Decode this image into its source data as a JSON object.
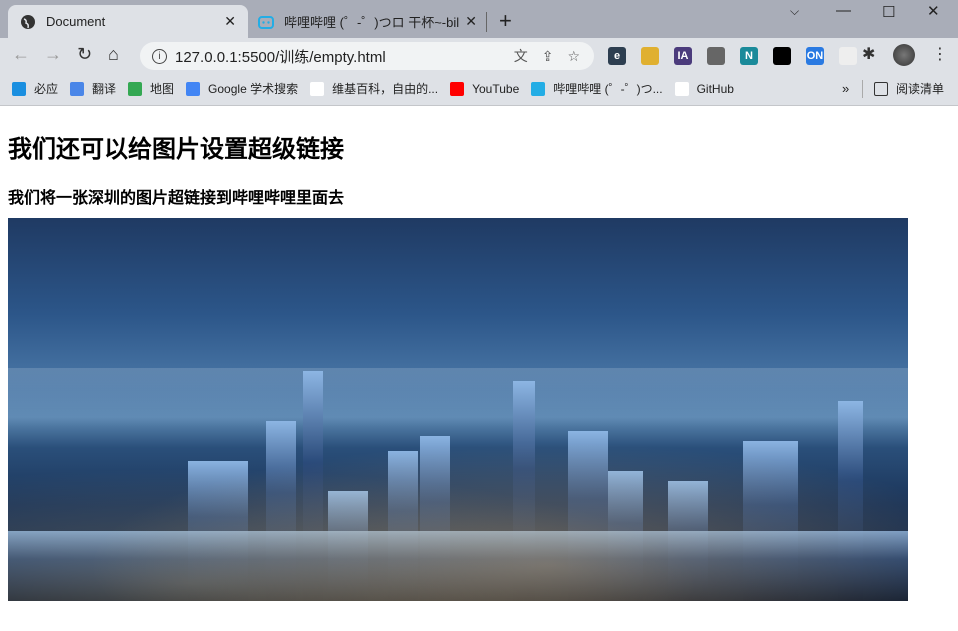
{
  "browser": {
    "tabs": [
      {
        "title": "Document",
        "active": true,
        "icon": "globe-icon"
      },
      {
        "title": "哔哩哔哩 (゜-゜)つロ 干杯~-bilil",
        "active": false,
        "icon": "bilibili-icon"
      }
    ],
    "address": "127.0.0.1:5500/训练/empty.html",
    "extensions": [
      {
        "icon": "e-icon",
        "label": "e",
        "color": "#2d3e50"
      },
      {
        "icon": "folder-clock-icon",
        "label": "",
        "color": "#e0b030"
      },
      {
        "icon": "ia-icon",
        "label": "IA",
        "color": "#4b3b7c"
      },
      {
        "icon": "copy-icon",
        "label": "",
        "color": "#666666"
      },
      {
        "icon": "n-icon",
        "label": "N",
        "color": "#1a8a9a"
      },
      {
        "icon": "tampermonkey-icon",
        "label": "",
        "color": "#000000"
      },
      {
        "icon": "info-on-icon",
        "label": "ON",
        "color": "#2a7ae2"
      },
      {
        "icon": "puzzle-piece-ext-icon",
        "label": "",
        "color": "#eeeeee"
      }
    ],
    "bookmarks": [
      {
        "label": "必应",
        "icon": "bing-icon",
        "color": "#1a8fe0"
      },
      {
        "label": "翻译",
        "icon": "google-translate-icon",
        "color": "#4a86e8"
      },
      {
        "label": "地图",
        "icon": "google-maps-icon",
        "color": "#34a853"
      },
      {
        "label": "Google 学术搜索",
        "icon": "scholar-icon",
        "color": "#4285f4"
      },
      {
        "label": "维基百科，自由的...",
        "icon": "wikipedia-icon",
        "color": "#ffffff"
      },
      {
        "label": "YouTube",
        "icon": "youtube-icon",
        "color": "#ff0000"
      },
      {
        "label": "哔哩哔哩 (゜-゜)つ...",
        "icon": "bilibili-icon",
        "color": "#23ade5"
      },
      {
        "label": "GitHub",
        "icon": "github-icon",
        "color": "#ffffff"
      }
    ],
    "reading_list": "阅读清单"
  },
  "page": {
    "heading": "我们还可以给图片设置超级链接",
    "subheading": "我们将一张深圳的图片超链接到哔哩哔哩里面去"
  }
}
